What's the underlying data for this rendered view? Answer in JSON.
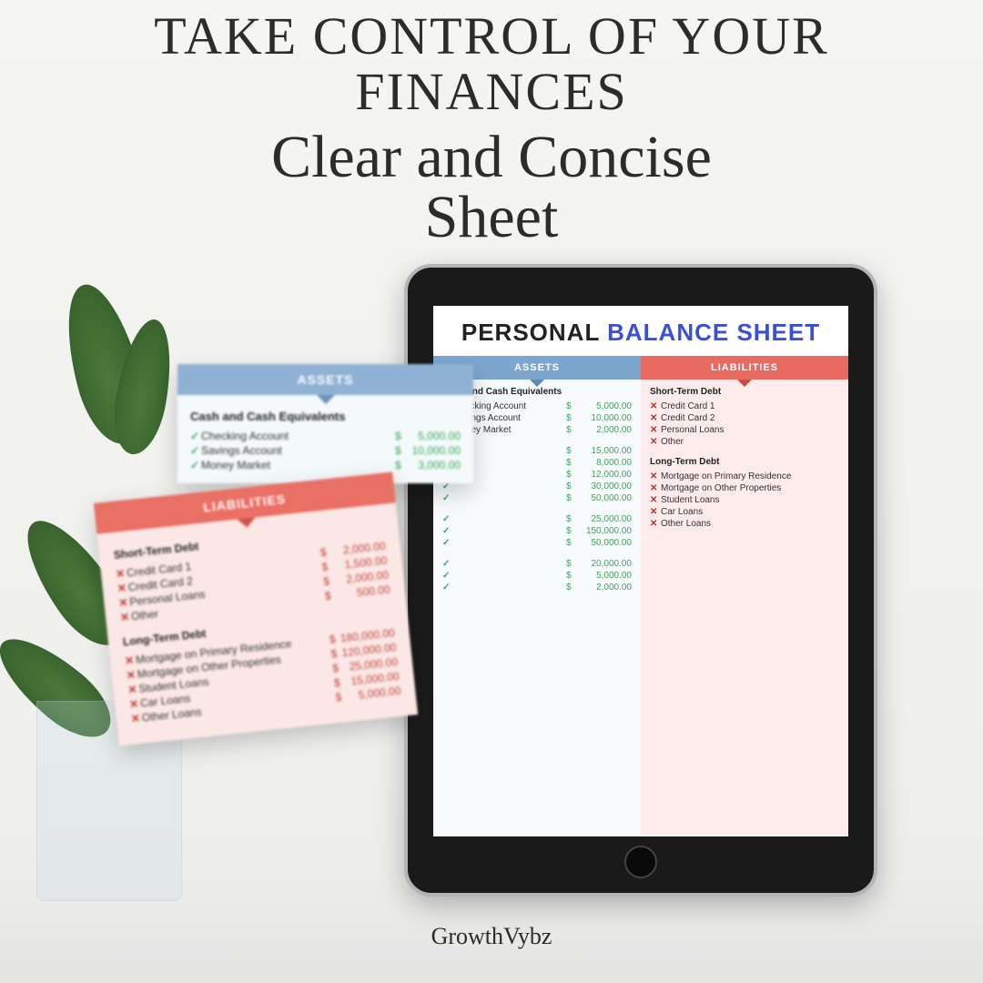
{
  "headline_line1": "TAKE CONTROL OF YOUR",
  "headline_line2": "FINANCES",
  "subhead_line1": "Clear and Concise",
  "subhead_line2": "Sheet",
  "brand": "GrowthVybz",
  "tablet": {
    "title_part1": "PERSONAL",
    "title_part2": "BALANCE SHEET",
    "assets_header": "ASSETS",
    "liab_header": "LIABILITIES",
    "assets": {
      "cash_h": "Cash and Cash Equivalents",
      "cash": [
        {
          "label": "Checking Account",
          "amt": "5,000.00"
        },
        {
          "label": "Savings Account",
          "amt": "10,000.00"
        },
        {
          "label": "Money Market",
          "amt": "2,000.00"
        }
      ],
      "mid_amounts": [
        "15,000.00",
        "8,000.00",
        "12,000.00",
        "30,000.00",
        "50,000.00"
      ],
      "mid2_amounts": [
        "25,000.00",
        "150,000.00",
        "50,000.00"
      ],
      "tail_amounts": [
        "20,000.00",
        "5,000.00",
        "2,000.00"
      ]
    },
    "liab": {
      "short_h": "Short-Term Debt",
      "short": [
        "Credit Card 1",
        "Credit Card 2",
        "Personal Loans",
        "Other"
      ],
      "long_h": "Long-Term Debt",
      "long": [
        "Mortgage on Primary Residence",
        "Mortgage on Other Properties",
        "Student Loans",
        "Car Loans",
        "Other Loans"
      ]
    }
  },
  "assets_card": {
    "header": "ASSETS",
    "section": "Cash and Cash Equivalents",
    "rows": [
      {
        "label": "Checking Account",
        "amt": "5,000.00"
      },
      {
        "label": "Savings Account",
        "amt": "10,000.00"
      },
      {
        "label": "Money Market",
        "amt": "3,000.00"
      }
    ]
  },
  "liab_card": {
    "header": "LIABILITIES",
    "short_h": "Short-Term Debt",
    "short": [
      {
        "label": "Credit Card 1",
        "amt": "2,000.00"
      },
      {
        "label": "Credit Card 2",
        "amt": "1,500.00"
      },
      {
        "label": "Personal Loans",
        "amt": "2,000.00"
      },
      {
        "label": "Other",
        "amt": "500.00"
      }
    ],
    "long_h": "Long-Term Debt",
    "long": [
      {
        "label": "Mortgage on Primary Residence",
        "amt": "180,000.00"
      },
      {
        "label": "Mortgage on Other Properties",
        "amt": "120,000.00"
      },
      {
        "label": "Student Loans",
        "amt": "25,000.00"
      },
      {
        "label": "Car Loans",
        "amt": "15,000.00"
      },
      {
        "label": "Other Loans",
        "amt": "5,000.00"
      }
    ]
  }
}
